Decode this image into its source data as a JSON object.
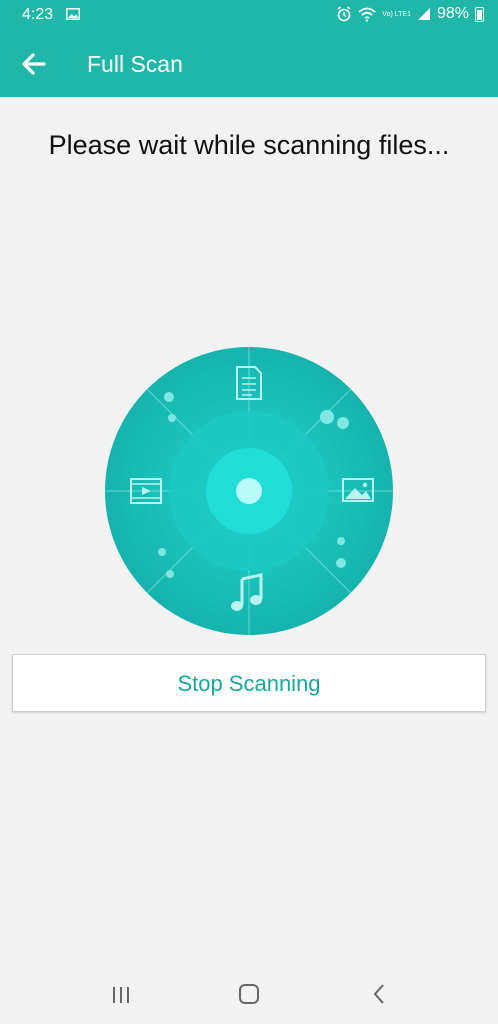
{
  "status_bar": {
    "time": "4:23",
    "network_label": "Vo) LTE1",
    "battery_text": "98%",
    "icons": [
      "image-notification-icon",
      "alarm-icon",
      "wifi-icon",
      "signal-icon",
      "battery-icon"
    ]
  },
  "app_bar": {
    "title": "Full Scan",
    "back_icon": "arrow-left-icon"
  },
  "main": {
    "message": "Please wait while scanning files...",
    "scanner_icons": [
      "document-icon",
      "image-icon",
      "music-icon",
      "video-icon"
    ],
    "stop_button_label": "Stop Scanning"
  },
  "nav_bar": {
    "items": [
      "recents-icon",
      "home-icon",
      "back-icon"
    ]
  },
  "colors": {
    "primary": "#1fb8a8",
    "accent_text": "#1aa89a",
    "scanner_outer": "#1cc3c0",
    "background": "#f2f2f2"
  }
}
